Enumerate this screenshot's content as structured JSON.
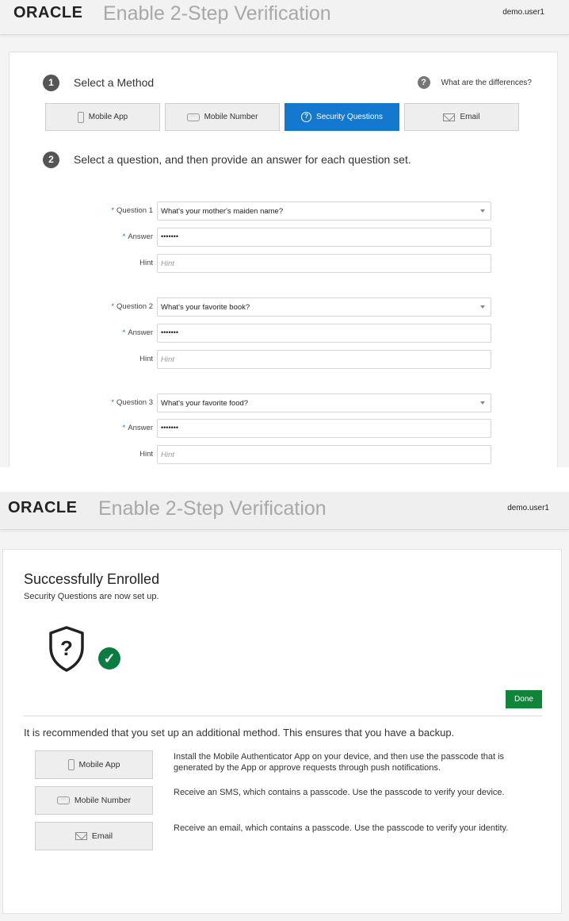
{
  "screen1": {
    "header": {
      "logo": "ORACLE",
      "title": "Enable 2-Step Verification",
      "user": "demo.user1"
    },
    "step1": {
      "number": "1",
      "label": "Select a Method",
      "help_text": "What are the differences?",
      "help_icon": "?"
    },
    "methods": [
      {
        "label": "Mobile App",
        "icon": "phone-icon",
        "active": false
      },
      {
        "label": "Mobile Number",
        "icon": "chat-icon",
        "active": false
      },
      {
        "label": "Security Questions",
        "icon": "shield-question-icon",
        "active": true
      },
      {
        "label": "Email",
        "icon": "mail-icon",
        "active": false
      }
    ],
    "step2": {
      "number": "2",
      "label": "Select a question, and then provide an answer for each question set."
    },
    "required_marker": "*",
    "question_sets": [
      {
        "question_label": "Question 1",
        "question_value": "What's your mother's maiden name?",
        "answer_label": "Answer",
        "answer_value": "•••••••",
        "hint_label": "Hint",
        "hint_placeholder": "Hint"
      },
      {
        "question_label": "Question 2",
        "question_value": "What's your favorite book?",
        "answer_label": "Answer",
        "answer_value": "•••••••",
        "hint_label": "Hint",
        "hint_placeholder": "Hint"
      },
      {
        "question_label": "Question 3",
        "question_value": "What's your favorite food?",
        "answer_label": "Answer",
        "answer_value": "•••••••",
        "hint_label": "Hint",
        "hint_placeholder": "Hint"
      }
    ]
  },
  "screen2": {
    "header": {
      "logo": "ORACLE",
      "title": "Enable 2-Step Verification",
      "user": "demo.user1"
    },
    "success_title": "Successfully Enrolled",
    "success_sub": "Security Questions are now set up.",
    "shield_glyph": "?",
    "check_glyph": "✓",
    "done_label": "Done",
    "recommend_text": "It is recommended that you set up an additional method. This ensures that you have a backup.",
    "alternatives": [
      {
        "label": "Mobile App",
        "icon": "phone-icon",
        "description": "Install the Mobile Authenticator App on your device, and then use the passcode that is generated by the App or approve requests through push notifications."
      },
      {
        "label": "Mobile Number",
        "icon": "chat-icon",
        "description": "Receive an SMS, which contains a passcode. Use the passcode to verify your device."
      },
      {
        "label": "Email",
        "icon": "mail-icon",
        "description": "Receive an email, which contains a passcode. Use the passcode to verify your identity."
      }
    ]
  },
  "colors": {
    "accent_blue": "#1378ce",
    "success_green": "#10853a",
    "header_title_gray": "#a8a8a8"
  }
}
